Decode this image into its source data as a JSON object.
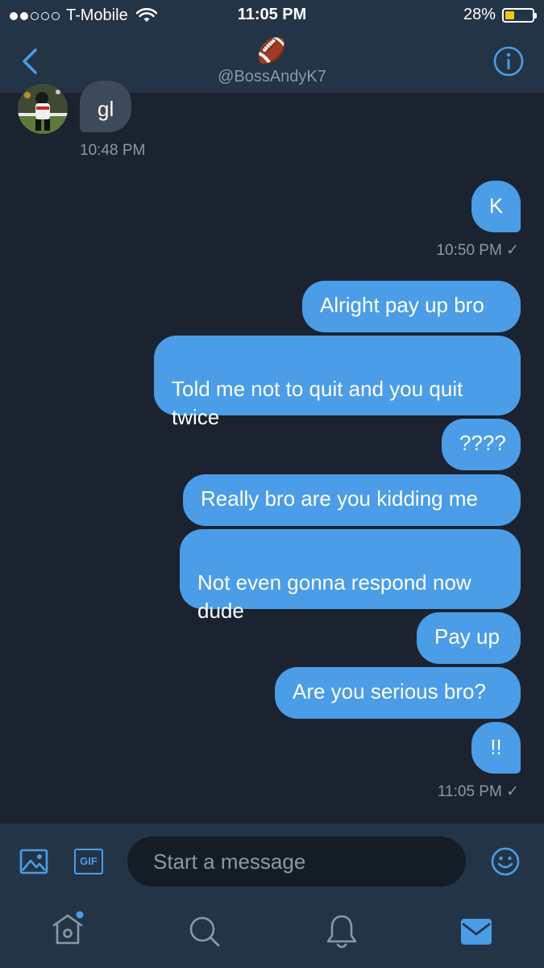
{
  "status_bar": {
    "carrier": "T-Mobile",
    "time": "11:05 PM",
    "battery": "28%",
    "battery_level": 0.28,
    "signal_bars_filled": 2,
    "signal_bars_total": 5
  },
  "header": {
    "emoji": "🏈",
    "handle": "@BossAndyK7",
    "back_icon": "chevron-left-icon",
    "info_icon": "info-icon"
  },
  "messages": [
    {
      "from": "them",
      "text": "gl"
    },
    {
      "from": "me",
      "text": "K"
    },
    {
      "from": "me",
      "text": "Alright pay up bro"
    },
    {
      "from": "me",
      "text": "Told me not to quit and you quit\ntwice"
    },
    {
      "from": "me",
      "text": "????"
    },
    {
      "from": "me",
      "text": "Really bro are you kidding me"
    },
    {
      "from": "me",
      "text": "Not even gonna respond now\ndude"
    },
    {
      "from": "me",
      "text": "Pay up"
    },
    {
      "from": "me",
      "text": "Are you serious bro?"
    },
    {
      "from": "me",
      "text": "!!"
    }
  ],
  "timestamps": {
    "t1": "10:48 PM",
    "t2": "10:50 PM ✓",
    "t3": "11:05 PM ✓"
  },
  "composer": {
    "placeholder": "Start a message",
    "gif_label": "GIF"
  },
  "tabbar": {
    "items": [
      "home-icon",
      "search-icon",
      "notifications-icon",
      "messages-icon"
    ],
    "active": "messages-icon"
  },
  "colors": {
    "background": "#1b2330",
    "bar": "#243447",
    "accent": "#4a9de6",
    "bubble_them": "#3d4a59",
    "muted": "#8899a6"
  }
}
